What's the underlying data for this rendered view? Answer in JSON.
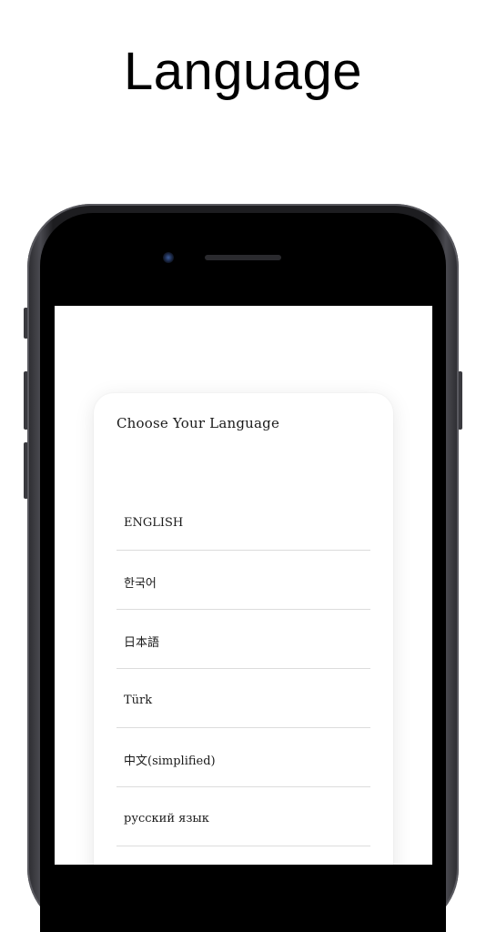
{
  "promo": {
    "title": "Language"
  },
  "dialog": {
    "title": "Choose Your Language",
    "languages": [
      {
        "label": "ENGLISH"
      },
      {
        "label": "한국어"
      },
      {
        "label": "日本語"
      },
      {
        "label": "Türk"
      },
      {
        "label": "中文(simplified)"
      },
      {
        "label": "русский язык"
      }
    ]
  },
  "colors": {
    "background": "#ffffff",
    "phone_frame": "#1d1d20",
    "divider": "#dcdcdc",
    "text": "#1a1a1a"
  }
}
